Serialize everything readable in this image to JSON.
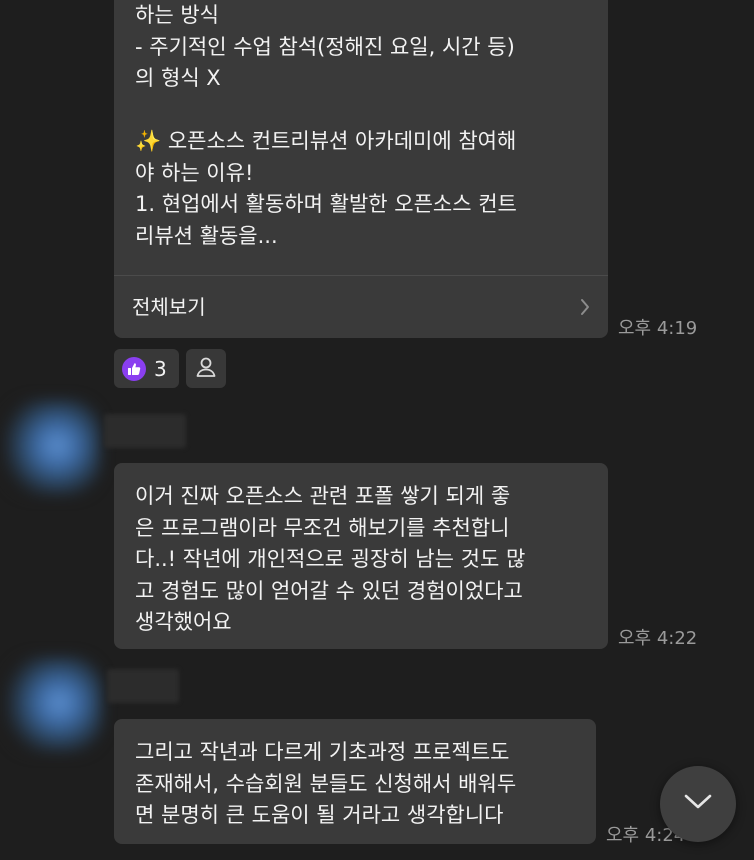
{
  "messages": [
    {
      "text": "하는 방식\n- 주기적인 수업 참석(정해진 요일, 시간 등)\n의 형식 X\n\n✨ 오픈소스 컨트리뷰션 아카데미에 참여해\n야 하는 이유!\n1. 현업에서 활동하며 활발한 오픈소스 컨트\n리뷰션 활동을...",
      "view_all_label": "전체보기",
      "time": "오후 4:19",
      "reactions": {
        "like_count": "3",
        "like_icon": "thumbs-up-icon",
        "add_icon": "person-icon",
        "like_color": "#8a3ff0"
      }
    },
    {
      "text": "이거 진짜 오픈소스 관련 포폴 쌓기 되게 좋\n은 프로그램이라 무조건 해보기를 추천합니\n다..! 작년에 개인적으로 굉장히 남는 것도 많\n고 경험도 많이 얻어갈 수 있던 경험이었다고\n생각했어요",
      "time": "오후 4:22"
    },
    {
      "text": "그리고 작년과 다르게 기초과정 프로젝트도\n존재해서, 수습회원 분들도 신청해서 배워두\n면 분명히 큰 도움이 될 거라고 생각합니다",
      "time": "오후 4:24"
    }
  ],
  "scroll_down_icon": "chevron-down-icon",
  "colors": {
    "background": "#1e1e1e",
    "bubble": "#3a3a3a",
    "time_text": "#9a9a9a"
  }
}
